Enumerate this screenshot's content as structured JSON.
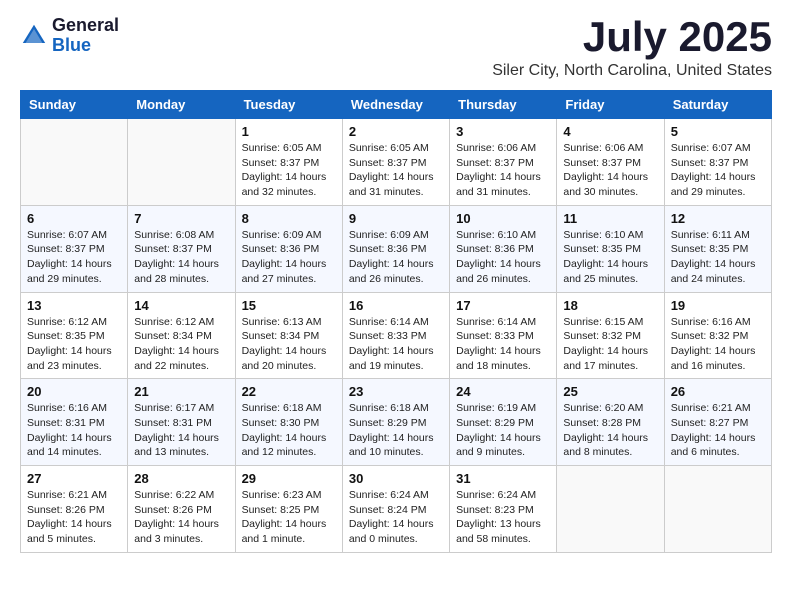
{
  "header": {
    "logo_general": "General",
    "logo_blue": "Blue",
    "month_title": "July 2025",
    "location": "Siler City, North Carolina, United States"
  },
  "weekdays": [
    "Sunday",
    "Monday",
    "Tuesday",
    "Wednesday",
    "Thursday",
    "Friday",
    "Saturday"
  ],
  "weeks": [
    [
      {
        "day": "",
        "sunrise": "",
        "sunset": "",
        "daylight": ""
      },
      {
        "day": "",
        "sunrise": "",
        "sunset": "",
        "daylight": ""
      },
      {
        "day": "1",
        "sunrise": "Sunrise: 6:05 AM",
        "sunset": "Sunset: 8:37 PM",
        "daylight": "Daylight: 14 hours and 32 minutes."
      },
      {
        "day": "2",
        "sunrise": "Sunrise: 6:05 AM",
        "sunset": "Sunset: 8:37 PM",
        "daylight": "Daylight: 14 hours and 31 minutes."
      },
      {
        "day": "3",
        "sunrise": "Sunrise: 6:06 AM",
        "sunset": "Sunset: 8:37 PM",
        "daylight": "Daylight: 14 hours and 31 minutes."
      },
      {
        "day": "4",
        "sunrise": "Sunrise: 6:06 AM",
        "sunset": "Sunset: 8:37 PM",
        "daylight": "Daylight: 14 hours and 30 minutes."
      },
      {
        "day": "5",
        "sunrise": "Sunrise: 6:07 AM",
        "sunset": "Sunset: 8:37 PM",
        "daylight": "Daylight: 14 hours and 29 minutes."
      }
    ],
    [
      {
        "day": "6",
        "sunrise": "Sunrise: 6:07 AM",
        "sunset": "Sunset: 8:37 PM",
        "daylight": "Daylight: 14 hours and 29 minutes."
      },
      {
        "day": "7",
        "sunrise": "Sunrise: 6:08 AM",
        "sunset": "Sunset: 8:37 PM",
        "daylight": "Daylight: 14 hours and 28 minutes."
      },
      {
        "day": "8",
        "sunrise": "Sunrise: 6:09 AM",
        "sunset": "Sunset: 8:36 PM",
        "daylight": "Daylight: 14 hours and 27 minutes."
      },
      {
        "day": "9",
        "sunrise": "Sunrise: 6:09 AM",
        "sunset": "Sunset: 8:36 PM",
        "daylight": "Daylight: 14 hours and 26 minutes."
      },
      {
        "day": "10",
        "sunrise": "Sunrise: 6:10 AM",
        "sunset": "Sunset: 8:36 PM",
        "daylight": "Daylight: 14 hours and 26 minutes."
      },
      {
        "day": "11",
        "sunrise": "Sunrise: 6:10 AM",
        "sunset": "Sunset: 8:35 PM",
        "daylight": "Daylight: 14 hours and 25 minutes."
      },
      {
        "day": "12",
        "sunrise": "Sunrise: 6:11 AM",
        "sunset": "Sunset: 8:35 PM",
        "daylight": "Daylight: 14 hours and 24 minutes."
      }
    ],
    [
      {
        "day": "13",
        "sunrise": "Sunrise: 6:12 AM",
        "sunset": "Sunset: 8:35 PM",
        "daylight": "Daylight: 14 hours and 23 minutes."
      },
      {
        "day": "14",
        "sunrise": "Sunrise: 6:12 AM",
        "sunset": "Sunset: 8:34 PM",
        "daylight": "Daylight: 14 hours and 22 minutes."
      },
      {
        "day": "15",
        "sunrise": "Sunrise: 6:13 AM",
        "sunset": "Sunset: 8:34 PM",
        "daylight": "Daylight: 14 hours and 20 minutes."
      },
      {
        "day": "16",
        "sunrise": "Sunrise: 6:14 AM",
        "sunset": "Sunset: 8:33 PM",
        "daylight": "Daylight: 14 hours and 19 minutes."
      },
      {
        "day": "17",
        "sunrise": "Sunrise: 6:14 AM",
        "sunset": "Sunset: 8:33 PM",
        "daylight": "Daylight: 14 hours and 18 minutes."
      },
      {
        "day": "18",
        "sunrise": "Sunrise: 6:15 AM",
        "sunset": "Sunset: 8:32 PM",
        "daylight": "Daylight: 14 hours and 17 minutes."
      },
      {
        "day": "19",
        "sunrise": "Sunrise: 6:16 AM",
        "sunset": "Sunset: 8:32 PM",
        "daylight": "Daylight: 14 hours and 16 minutes."
      }
    ],
    [
      {
        "day": "20",
        "sunrise": "Sunrise: 6:16 AM",
        "sunset": "Sunset: 8:31 PM",
        "daylight": "Daylight: 14 hours and 14 minutes."
      },
      {
        "day": "21",
        "sunrise": "Sunrise: 6:17 AM",
        "sunset": "Sunset: 8:31 PM",
        "daylight": "Daylight: 14 hours and 13 minutes."
      },
      {
        "day": "22",
        "sunrise": "Sunrise: 6:18 AM",
        "sunset": "Sunset: 8:30 PM",
        "daylight": "Daylight: 14 hours and 12 minutes."
      },
      {
        "day": "23",
        "sunrise": "Sunrise: 6:18 AM",
        "sunset": "Sunset: 8:29 PM",
        "daylight": "Daylight: 14 hours and 10 minutes."
      },
      {
        "day": "24",
        "sunrise": "Sunrise: 6:19 AM",
        "sunset": "Sunset: 8:29 PM",
        "daylight": "Daylight: 14 hours and 9 minutes."
      },
      {
        "day": "25",
        "sunrise": "Sunrise: 6:20 AM",
        "sunset": "Sunset: 8:28 PM",
        "daylight": "Daylight: 14 hours and 8 minutes."
      },
      {
        "day": "26",
        "sunrise": "Sunrise: 6:21 AM",
        "sunset": "Sunset: 8:27 PM",
        "daylight": "Daylight: 14 hours and 6 minutes."
      }
    ],
    [
      {
        "day": "27",
        "sunrise": "Sunrise: 6:21 AM",
        "sunset": "Sunset: 8:26 PM",
        "daylight": "Daylight: 14 hours and 5 minutes."
      },
      {
        "day": "28",
        "sunrise": "Sunrise: 6:22 AM",
        "sunset": "Sunset: 8:26 PM",
        "daylight": "Daylight: 14 hours and 3 minutes."
      },
      {
        "day": "29",
        "sunrise": "Sunrise: 6:23 AM",
        "sunset": "Sunset: 8:25 PM",
        "daylight": "Daylight: 14 hours and 1 minute."
      },
      {
        "day": "30",
        "sunrise": "Sunrise: 6:24 AM",
        "sunset": "Sunset: 8:24 PM",
        "daylight": "Daylight: 14 hours and 0 minutes."
      },
      {
        "day": "31",
        "sunrise": "Sunrise: 6:24 AM",
        "sunset": "Sunset: 8:23 PM",
        "daylight": "Daylight: 13 hours and 58 minutes."
      },
      {
        "day": "",
        "sunrise": "",
        "sunset": "",
        "daylight": ""
      },
      {
        "day": "",
        "sunrise": "",
        "sunset": "",
        "daylight": ""
      }
    ]
  ]
}
